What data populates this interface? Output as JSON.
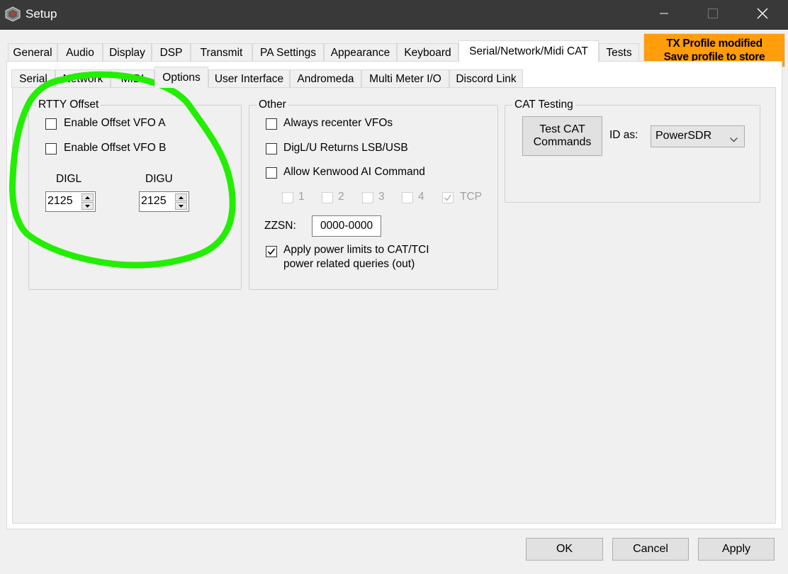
{
  "window": {
    "title": "Setup"
  },
  "main_tabs": [
    {
      "label": "General"
    },
    {
      "label": "Audio"
    },
    {
      "label": "Display"
    },
    {
      "label": "DSP"
    },
    {
      "label": "Transmit"
    },
    {
      "label": "PA Settings"
    },
    {
      "label": "Appearance"
    },
    {
      "label": "Keyboard"
    },
    {
      "label": "Serial/Network/Midi CAT",
      "active": true
    },
    {
      "label": "Tests"
    }
  ],
  "banner": {
    "line1": "TX Profile modified",
    "line2": "Save profile to store",
    "color": "#ff9d0a"
  },
  "sub_tabs": [
    {
      "label": "Serial"
    },
    {
      "label": "Network"
    },
    {
      "label": "MIDI"
    },
    {
      "label": "Options",
      "active": true
    },
    {
      "label": "User Interface"
    },
    {
      "label": "Andromeda"
    },
    {
      "label": "Multi Meter I/O"
    },
    {
      "label": "Discord Link"
    }
  ],
  "rtty": {
    "title": "RTTY Offset",
    "enable_a": {
      "label": "Enable Offset VFO A",
      "checked": false
    },
    "enable_b": {
      "label": "Enable Offset VFO B",
      "checked": false
    },
    "digl_label": "DIGL",
    "digu_label": "DIGU",
    "digl_value": "2125",
    "digu_value": "2125"
  },
  "other": {
    "title": "Other",
    "recenter": {
      "label": "Always recenter VFOs",
      "checked": false
    },
    "digl_returns": {
      "label": "DigL/U Returns LSB/USB",
      "checked": false
    },
    "kenwood": {
      "label": "Allow Kenwood AI Command",
      "checked": false
    },
    "ports": [
      {
        "label": "1",
        "checked": false
      },
      {
        "label": "2",
        "checked": false
      },
      {
        "label": "3",
        "checked": false
      },
      {
        "label": "4",
        "checked": false
      },
      {
        "label": "TCP",
        "checked": true
      }
    ],
    "zzsn_label": "ZZSN:",
    "zzsn_value": "0000-0000",
    "power_limits": {
      "line1": "Apply power limits to CAT/TCI",
      "line2": "power related queries (out)",
      "checked": true
    }
  },
  "cat_testing": {
    "title": "CAT Testing",
    "test_button_line1": "Test CAT",
    "test_button_line2": "Commands",
    "id_as_label": "ID as:",
    "id_as_value": "PowerSDR"
  },
  "footer": {
    "ok": "OK",
    "cancel": "Cancel",
    "apply": "Apply"
  },
  "annotation": {
    "color": "#22ee00"
  }
}
